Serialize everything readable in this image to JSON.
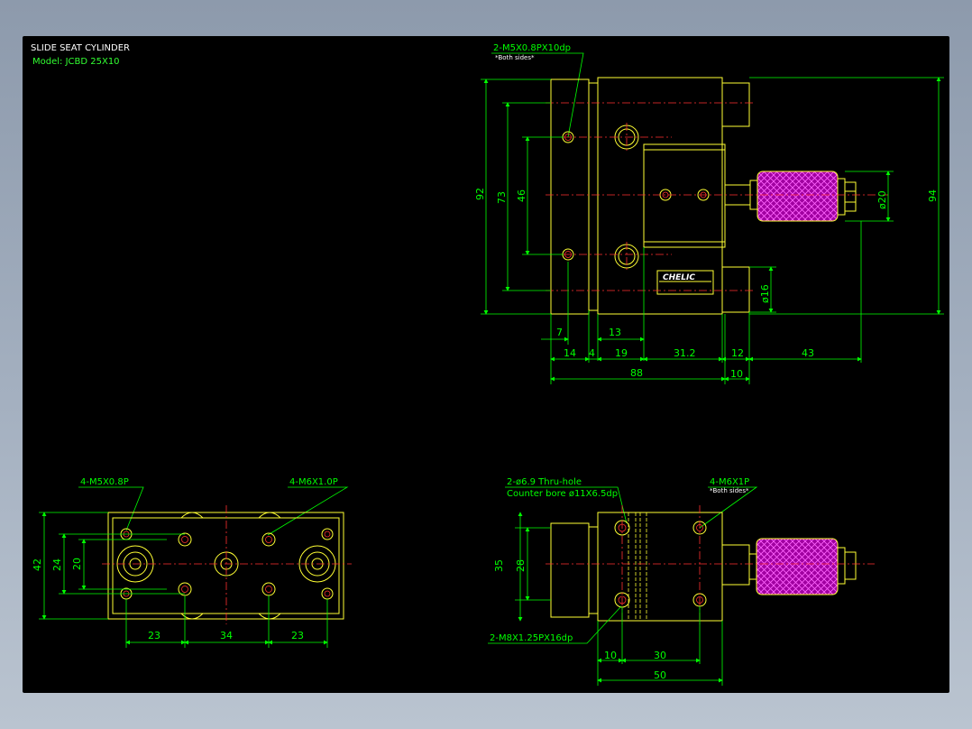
{
  "title": "SLIDE SEAT CYLINDER",
  "model": "Model:  JCBD 25X10",
  "logo": "CHELIC",
  "colors": {
    "background": "#000000",
    "outline": "#ffff33",
    "dimension": "#00ff00",
    "centerline": "#ff3030",
    "knurl": "#b400b4"
  },
  "top_right_view": {
    "note_tap": "2-M5X0.8PX10dp",
    "note_tap_sub": "*Both sides*",
    "dims": {
      "d92": "92",
      "d73": "73",
      "d46": "46",
      "d94": "94",
      "d20": "ø20",
      "d16": "ø16",
      "d7": "7",
      "d13": "13",
      "d14": "14",
      "d4": "4",
      "d19": "19",
      "d31": "31.2",
      "d12": "12",
      "d43": "43",
      "d88": "88",
      "d10": "10"
    }
  },
  "bottom_left_view": {
    "note_m5": "4-M5X0.8P",
    "note_m6": "4-M6X1.0P",
    "dims": {
      "d42": "42",
      "d24": "24",
      "d20": "20",
      "d23a": "23",
      "d34": "34",
      "d23b": "23"
    }
  },
  "bottom_right_view": {
    "note_thru": "2-ø6.9  Thru-hole",
    "note_cbore": "Counter bore  ø11X6.5dp",
    "note_m6": "4-M6X1P",
    "note_m6_sub": "*Both sides*",
    "note_m8": "2-M8X1.25PX16dp",
    "dims": {
      "d35": "35",
      "d28": "28",
      "d10": "10",
      "d30": "30",
      "d50": "50"
    }
  }
}
